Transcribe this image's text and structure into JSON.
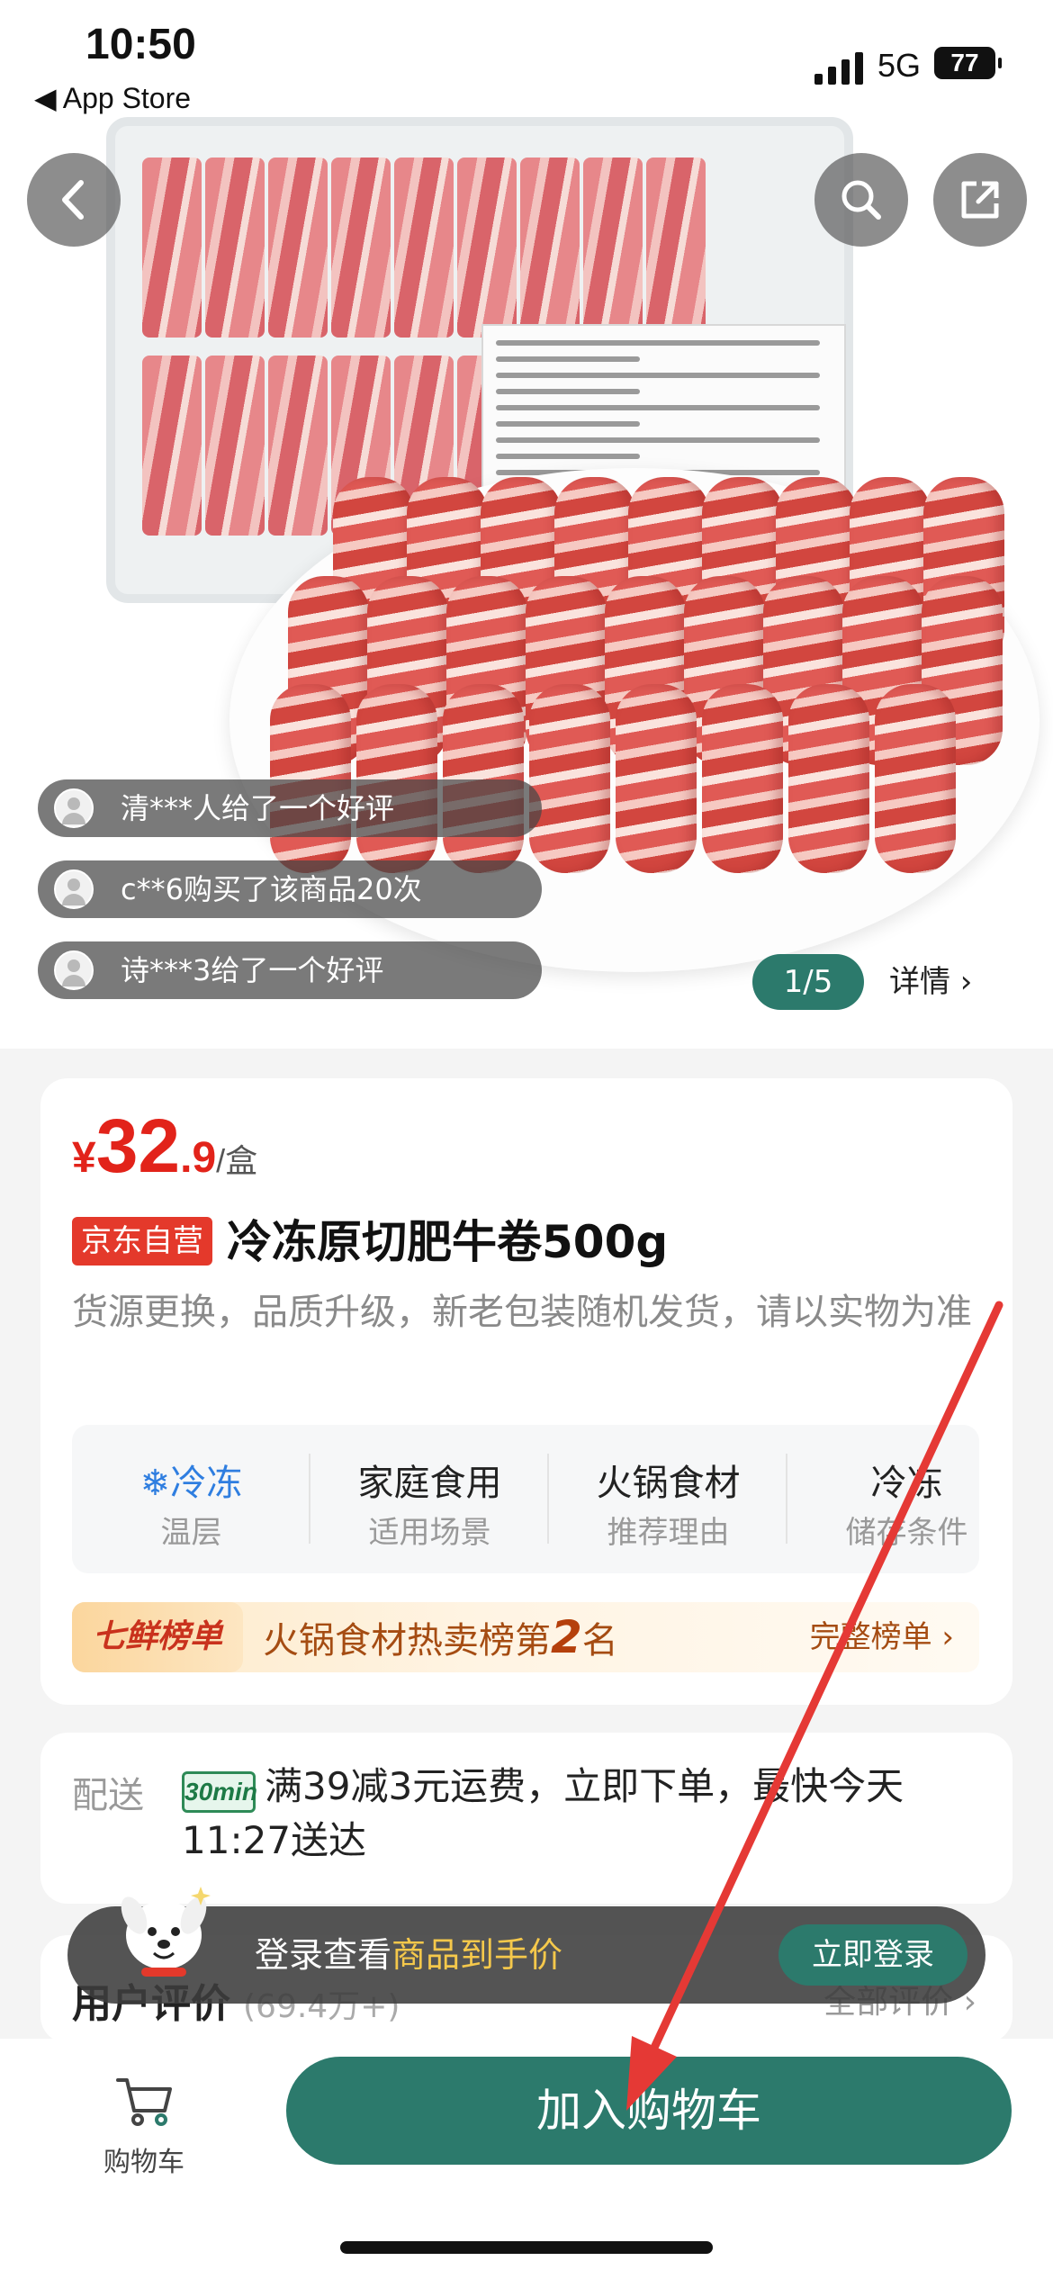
{
  "status_bar": {
    "time": "10:50",
    "back_app": "◀ App Store",
    "network": "5G",
    "battery": "77"
  },
  "hero": {
    "feed": [
      {
        "text": "清***人给了一个好评"
      },
      {
        "text": "c**6购买了该商品20次"
      },
      {
        "text": "诗***3给了一个好评"
      }
    ],
    "pager": "1/5",
    "detail_link": "详情 ›",
    "icons": {
      "back": "back-arrow-icon",
      "search": "search-icon",
      "share": "share-icon"
    }
  },
  "product": {
    "price": {
      "symbol": "¥",
      "integer": "32",
      "decimal": ".9",
      "unit": "/盒"
    },
    "self_tag": "京东自营",
    "title": "冷冻原切肥牛卷500g",
    "subtitle": "货源更换，品质升级，新老包装随机发货，请以实物为准",
    "attributes": [
      {
        "value": "❄冷冻",
        "key": "温层"
      },
      {
        "value": "家庭食用",
        "key": "适用场景"
      },
      {
        "value": "火锅食材",
        "key": "推荐理由"
      },
      {
        "value": "冷冻",
        "key": "储存条件"
      }
    ],
    "ranking": {
      "badge": "七鲜榜单",
      "text_before": "火锅食材热卖榜第",
      "rank": "2",
      "text_after": "名",
      "more": "完整榜单 ›"
    }
  },
  "delivery": {
    "label": "配送",
    "icon_text": "30min",
    "text": "满39减3元运费，立即下单，最快今天11:27送达"
  },
  "reviews": {
    "label": "用户评价",
    "count": "(69.4万+)",
    "all": "全部评价 ›"
  },
  "login_bar": {
    "text": "登录查看",
    "highlight": "商品到手价",
    "button": "立即登录"
  },
  "bottom": {
    "cart_label": "购物车",
    "add_to_cart": "加入购物车"
  },
  "colors": {
    "brand_green": "#2c7a6c",
    "price_red": "#e2231a",
    "annotation_arrow": "#e53935"
  }
}
